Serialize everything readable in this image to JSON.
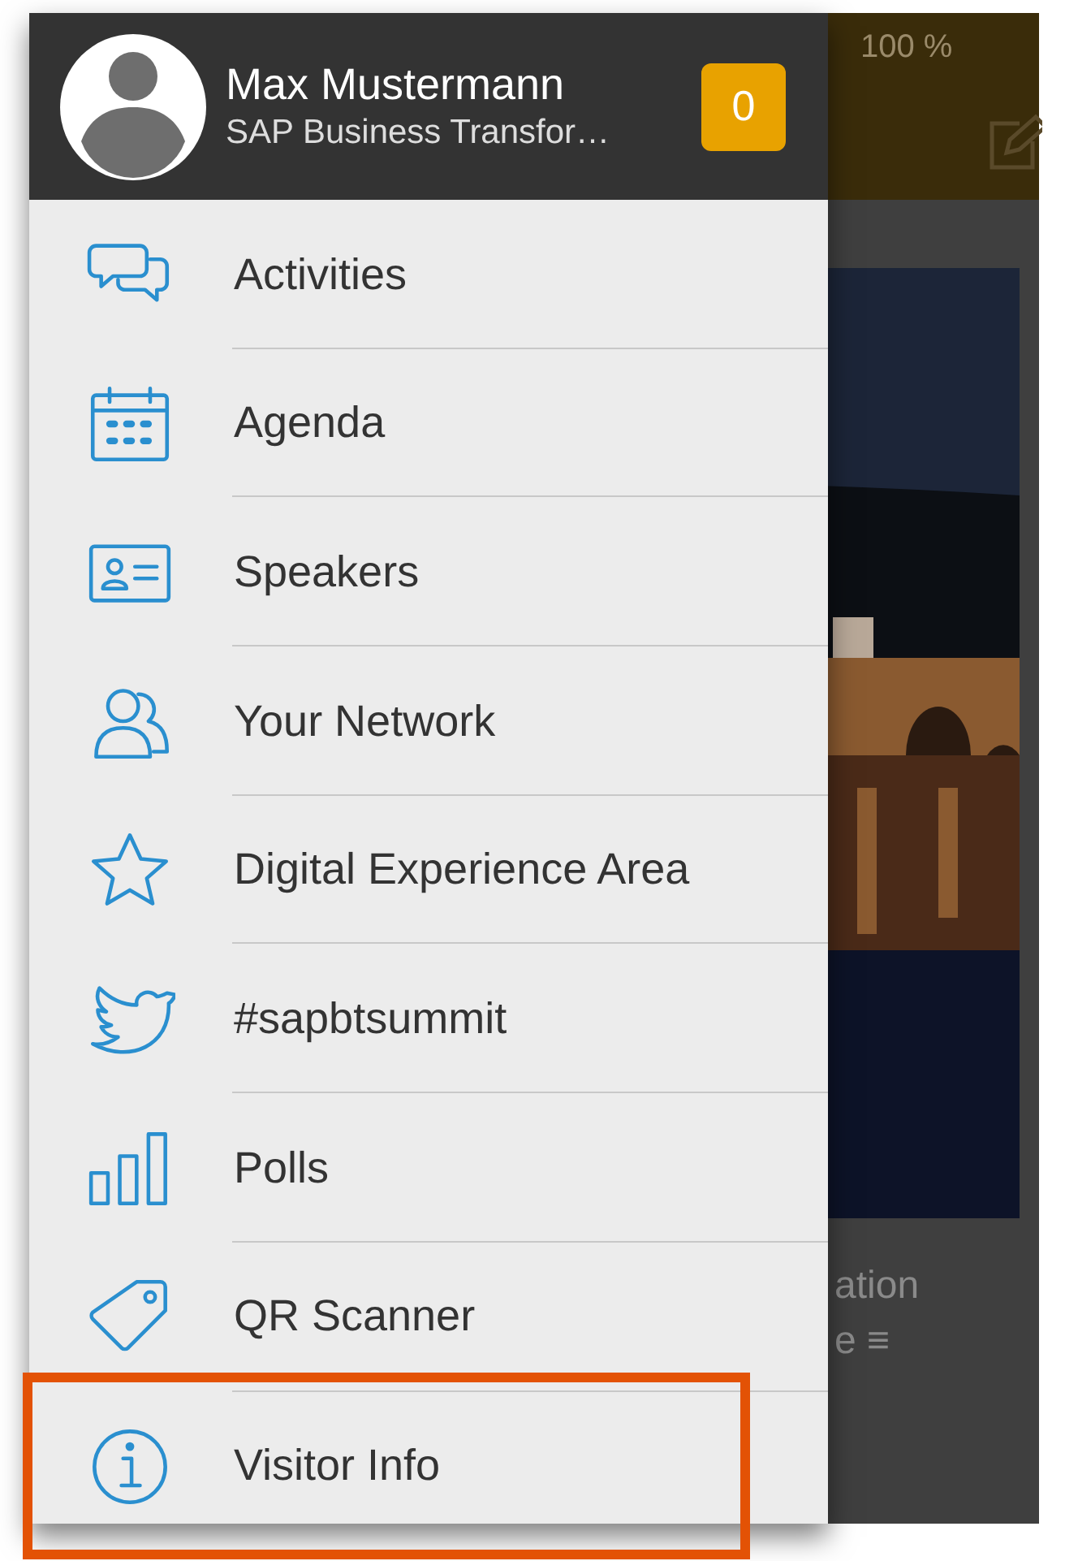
{
  "header": {
    "name": "Max Mustermann",
    "subtitle": "SAP Business Transfor…",
    "badge": "0"
  },
  "menu": [
    {
      "label": "Activities",
      "highlighted": false
    },
    {
      "label": "Agenda",
      "highlighted": false
    },
    {
      "label": "Speakers",
      "highlighted": false
    },
    {
      "label": "Your Network",
      "highlighted": false
    },
    {
      "label": "Digital Experience Area",
      "highlighted": false
    },
    {
      "label": "#sapbtsummit",
      "highlighted": false
    },
    {
      "label": "Polls",
      "highlighted": false
    },
    {
      "label": "QR Scanner",
      "highlighted": false
    },
    {
      "label": "Visitor Info",
      "highlighted": true
    }
  ],
  "background": {
    "battery": "100 %",
    "text_lines": [
      "ation",
      "e ≡"
    ],
    "kind": "picture"
  }
}
